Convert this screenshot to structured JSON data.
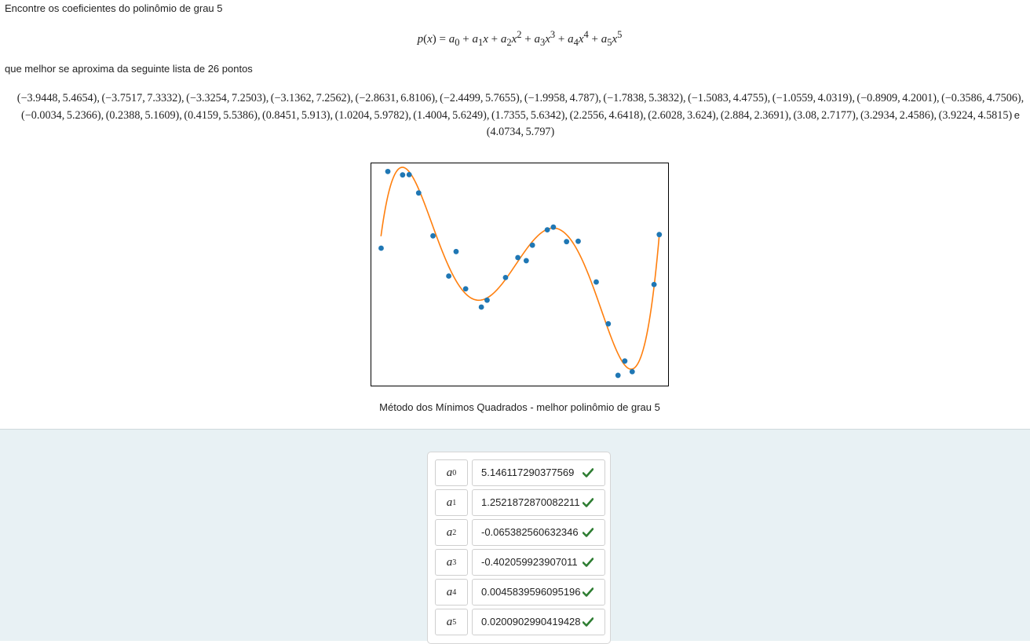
{
  "question": {
    "intro": "Encontre os coeficientes do polinômio de grau 5",
    "formula": {
      "lhs": "p(x) =",
      "terms": [
        "a0",
        "a1x",
        "a2x²",
        "a3x³",
        "a4x⁴",
        "a5x⁵"
      ]
    },
    "points_intro": "que melhor se aproxima da seguinte lista de 26 pontos",
    "points": [
      "(−3.9448, 5.4654)",
      "(−3.7517, 7.3332)",
      "(−3.3254, 7.2503)",
      "(−3.1362, 7.2562)",
      "(−2.8631, 6.8106)",
      "(−2.4499, 5.7655)",
      "(−1.9958, 4.787)",
      "(−1.7838, 5.3832)",
      "(−1.5083, 4.4755)",
      "(−1.0559, 4.0319)",
      "(−0.8909, 4.2001)",
      "(−0.3586, 4.7506)",
      "(−0.0034, 5.2366)",
      "(0.2388, 5.1609)",
      "(0.4159, 5.5386)",
      "(0.8451, 5.913)",
      "(1.0204, 5.9782)",
      "(1.4004, 5.6249)",
      "(1.7355, 5.6342)",
      "(2.2556, 4.6418)",
      "(2.6028, 3.624)",
      "(2.884, 2.3691)",
      "(3.08, 2.7177)",
      "(3.2934, 2.4586)",
      "(3.9224, 4.5815)",
      "(4.0734, 5.797)"
    ],
    "points_conjunction": "e",
    "caption": "Método dos Mínimos Quadrados - melhor polinômio de grau 5"
  },
  "chart_data": {
    "type": "scatter",
    "title": "",
    "xlabel": "",
    "ylabel": "",
    "axes_ticks": false,
    "grid": false,
    "xlim": [
      -4.25,
      4.35
    ],
    "ylim": [
      2.1,
      7.55
    ],
    "series": [
      {
        "kind": "points",
        "color": "#1f77b4",
        "points": [
          [
            -3.9448,
            5.4654
          ],
          [
            -3.7517,
            7.3332
          ],
          [
            -3.3254,
            7.2503
          ],
          [
            -3.1362,
            7.2562
          ],
          [
            -2.8631,
            6.8106
          ],
          [
            -2.4499,
            5.7655
          ],
          [
            -1.9958,
            4.787
          ],
          [
            -1.7838,
            5.3832
          ],
          [
            -1.5083,
            4.4755
          ],
          [
            -1.0559,
            4.0319
          ],
          [
            -0.8909,
            4.2001
          ],
          [
            -0.3586,
            4.7506
          ],
          [
            -0.0034,
            5.2366
          ],
          [
            0.2388,
            5.1609
          ],
          [
            0.4159,
            5.5386
          ],
          [
            0.8451,
            5.913
          ],
          [
            1.0204,
            5.9782
          ],
          [
            1.4004,
            5.6249
          ],
          [
            1.7355,
            5.6342
          ],
          [
            2.2556,
            4.6418
          ],
          [
            2.6028,
            3.624
          ],
          [
            2.884,
            2.3691
          ],
          [
            3.08,
            2.7177
          ],
          [
            3.2934,
            2.4586
          ],
          [
            3.9224,
            4.5815
          ],
          [
            4.0734,
            5.797
          ]
        ]
      },
      {
        "kind": "curve",
        "color": "#ff7f0e",
        "coefficients": [
          5.146117290377569,
          1.2521872870082211,
          -0.065382560632346,
          -0.402059923907011,
          0.0045839596095196,
          0.0200902990419428
        ],
        "domain": [
          -3.95,
          4.08
        ]
      }
    ]
  },
  "answers": {
    "coefficients": [
      {
        "sym": "a",
        "sub": "0",
        "value": "5.146117290377569"
      },
      {
        "sym": "a",
        "sub": "1",
        "value": "1.2521872870082211"
      },
      {
        "sym": "a",
        "sub": "2",
        "value": "-0.065382560632346"
      },
      {
        "sym": "a",
        "sub": "3",
        "value": "-0.402059923907011"
      },
      {
        "sym": "a",
        "sub": "4",
        "value": "0.0045839596095196"
      },
      {
        "sym": "a",
        "sub": "5",
        "value": "0.0200902990419428"
      }
    ],
    "status_icon": "check-icon",
    "status_color": "#2e7d32"
  }
}
